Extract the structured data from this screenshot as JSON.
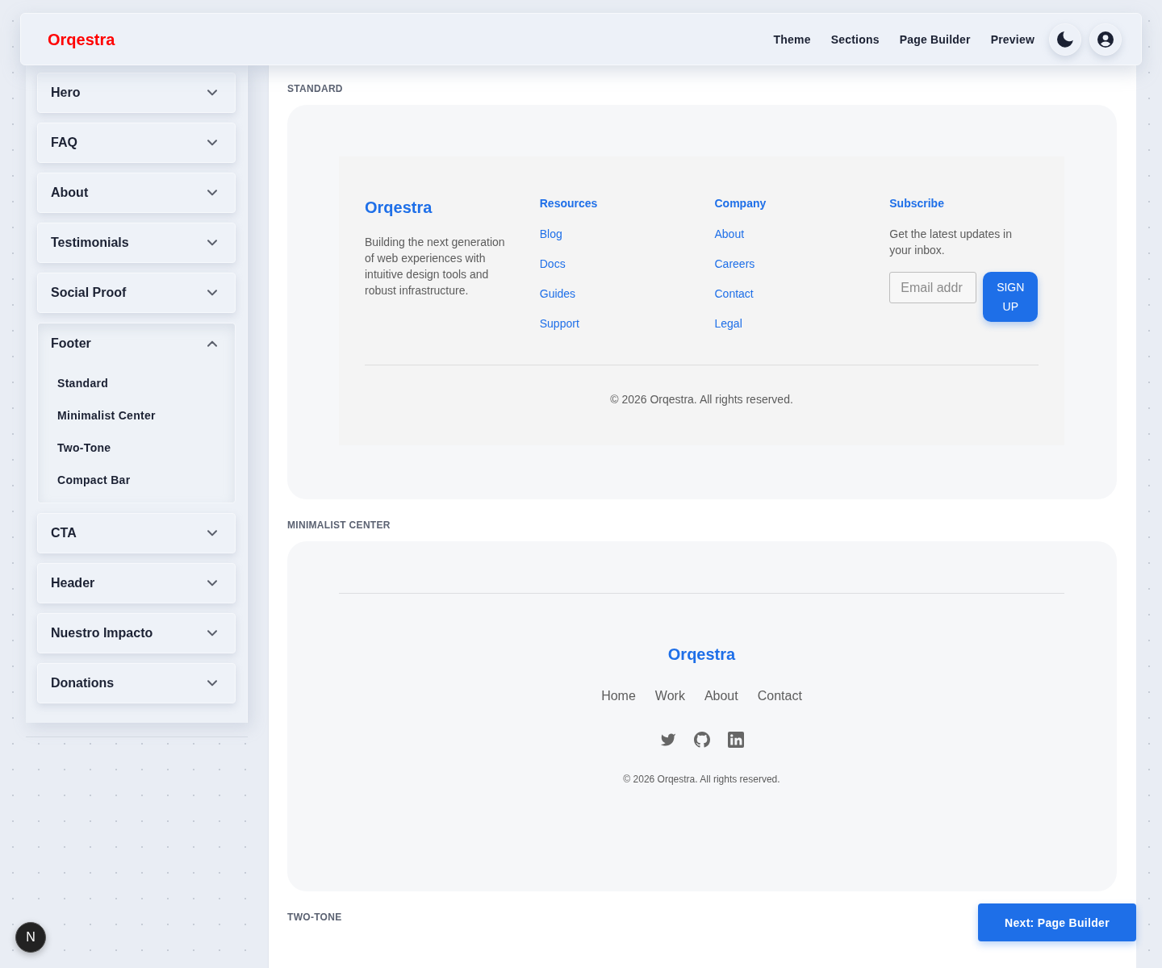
{
  "header": {
    "logo": "Orqestra",
    "nav": [
      {
        "label": "Theme"
      },
      {
        "label": "Sections"
      },
      {
        "label": "Page Builder"
      },
      {
        "label": "Preview"
      }
    ]
  },
  "sidebar": {
    "sections": [
      {
        "label": "Hero",
        "expanded": false
      },
      {
        "label": "FAQ",
        "expanded": false
      },
      {
        "label": "About",
        "expanded": false
      },
      {
        "label": "Testimonials",
        "expanded": false
      },
      {
        "label": "Social Proof",
        "expanded": false
      },
      {
        "label": "Footer",
        "expanded": true,
        "children": [
          {
            "label": "Standard"
          },
          {
            "label": "Minimalist Center"
          },
          {
            "label": "Two-Tone"
          },
          {
            "label": "Compact Bar"
          }
        ]
      },
      {
        "label": "CTA",
        "expanded": false
      },
      {
        "label": "Header",
        "expanded": false
      },
      {
        "label": "Nuestro Impacto",
        "expanded": false
      },
      {
        "label": "Donations",
        "expanded": false
      }
    ]
  },
  "main": {
    "sections": [
      {
        "label": "STANDARD",
        "kind": "standard",
        "preview": {
          "brand": "Orqestra",
          "description": "Building the next generation of web experiences with intuitive design tools and robust infrastructure.",
          "columns": [
            {
              "heading": "Resources",
              "links": [
                "Blog",
                "Docs",
                "Guides",
                "Support"
              ]
            },
            {
              "heading": "Company",
              "links": [
                "About",
                "Careers",
                "Contact",
                "Legal"
              ]
            }
          ],
          "subscribe": {
            "heading": "Subscribe",
            "text": "Get the latest updates in your inbox.",
            "email": {
              "placeholder": "Email addr"
            },
            "button": "SIGN UP"
          },
          "copyright": "© 2026 Orqestra. All rights reserved."
        }
      },
      {
        "label": "MINIMALIST CENTER",
        "kind": "minimalist",
        "preview": {
          "brand": "Orqestra",
          "links": [
            "Home",
            "Work",
            "About",
            "Contact"
          ],
          "copyright": "© 2026 Orqestra. All rights reserved."
        }
      },
      {
        "label": "TWO-TONE",
        "kind": "two-tone"
      }
    ]
  },
  "next_button": {
    "label": "Next: Page Builder"
  },
  "dev_badge": {
    "glyph": "N"
  }
}
